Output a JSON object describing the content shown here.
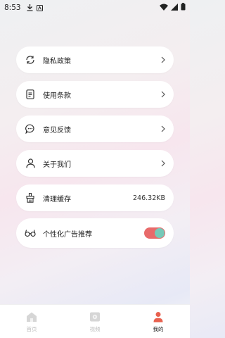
{
  "status_bar": {
    "time": "8:53"
  },
  "menu": {
    "privacy_policy": "隐私政策",
    "terms_of_use": "使用条款",
    "feedback": "意见反馈",
    "about_us": "关于我们",
    "clear_cache": "清理缓存",
    "cache_size": "246.32KB",
    "personalized_ads": "个性化广告推荐",
    "personalized_ads_enabled": true
  },
  "tabs": [
    {
      "label": "首页",
      "icon": "home-icon",
      "active": false
    },
    {
      "label": "视频",
      "icon": "video-icon",
      "active": false
    },
    {
      "label": "我的",
      "icon": "profile-icon",
      "active": true
    }
  ],
  "colors": {
    "toggle_track": "#e86a6a",
    "toggle_knob": "#76c9b8",
    "active_tab_icon": "#e8614f",
    "inactive_tab": "#bdbdbd"
  }
}
